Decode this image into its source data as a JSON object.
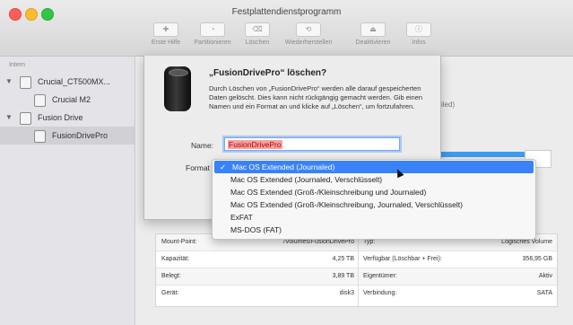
{
  "window": {
    "title": "Festplattendienstprogramm"
  },
  "toolbar": {
    "buttons": [
      {
        "label": "Erste Hilfe"
      },
      {
        "label": "Partitionieren"
      },
      {
        "label": "Löschen"
      },
      {
        "label": "Wiederherstellen"
      },
      {
        "label": "Deaktivieren"
      },
      {
        "label": "Infos"
      }
    ]
  },
  "sidebar": {
    "header": "Intern",
    "items": [
      {
        "label": "Crucial_CT500MX..."
      },
      {
        "label": "Crucial M2"
      },
      {
        "label": "Fusion Drive"
      },
      {
        "label": "FusionDrivePro"
      }
    ]
  },
  "background": {
    "partial_text": "iled)"
  },
  "dialog": {
    "title": "„FusionDrivePro“ löschen?",
    "body": "Durch Löschen von „FusionDrivePro“ werden alle darauf gespeicherten Daten gelöscht. Dies kann nicht rückgängig gemacht werden. Gib einen Namen und ein Format an und klicke auf „Löschen“, um fortzufahren.",
    "name_label": "Name:",
    "name_value": "FusionDrivePro",
    "format_label": "Format"
  },
  "format_menu": {
    "options": [
      "Mac OS Extended (Journaled)",
      "Mac OS Extended (Journaled, Verschlüsselt)",
      "Mac OS Extended (Groß-/Kleinschreibung und Journaled)",
      "Mac OS Extended (Groß-/Kleinschreibung, Journaled, Verschlüsselt)",
      "ExFAT",
      "MS-DOS (FAT)"
    ],
    "selected": "Mac OS Extended (Journaled)",
    "check": "✓"
  },
  "info": {
    "rows": [
      {
        "k1": "Mount-Point:",
        "v1": "/Volumes/FusionDrivePro",
        "k2": "Typ:",
        "v2": "Logisches Volume"
      },
      {
        "k1": "Kapazität:",
        "v1": "4,25 TB",
        "k2": "Verfügbar (Löschbar + Frei):",
        "v2": "356,95 GB"
      },
      {
        "k1": "Belegt:",
        "v1": "3,89 TB",
        "k2": "Eigentümer:",
        "v2": "Aktiv"
      },
      {
        "k1": "Gerät:",
        "v1": "disk3",
        "k2": "Verbindung:",
        "v2": "SATA"
      }
    ]
  }
}
